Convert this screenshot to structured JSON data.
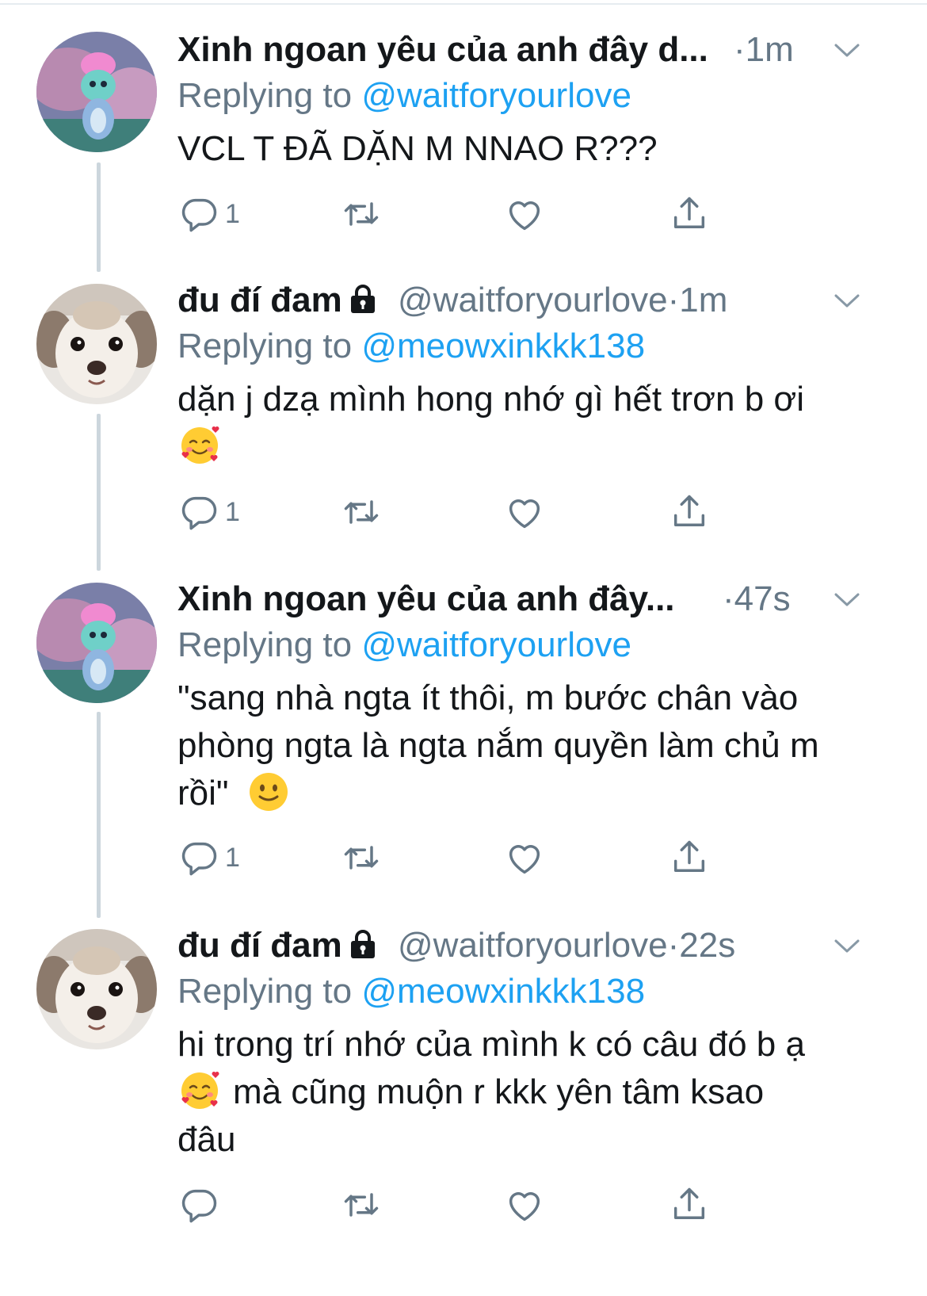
{
  "tweets": [
    {
      "name": "Xinh ngoan yêu của anh đây d...",
      "handle": "",
      "time": "·1m",
      "locked": false,
      "replying_prefix": "Replying to ",
      "replying_to": "@waitforyourlove",
      "text_lines": [
        "VCL T ĐÃ DẶN M NNAO R???"
      ],
      "reply_count": "1",
      "avatar": "pink-hair-cartoon-avatar"
    },
    {
      "name": "đu đí đam",
      "handle": "@waitforyourlove",
      "time": "·1m",
      "locked": true,
      "replying_prefix": "Replying to ",
      "replying_to": "@meowxinkkk138",
      "text_lines": [
        "dặn j dzạ mình hong nhớ gì hết trơn b ơi"
      ],
      "reply_count": "1",
      "avatar": "chihuahua-avatar"
    },
    {
      "name": "Xinh ngoan yêu của anh đây...",
      "handle": "",
      "time": "·47s",
      "locked": false,
      "replying_prefix": "Replying to ",
      "replying_to": "@waitforyourlove",
      "text_lines": [
        "\"sang nhà ngta ít thôi, m bước chân vào",
        "phòng ngta là ngta nắm quyền làm chủ m",
        "rồi\""
      ],
      "reply_count": "1",
      "avatar": "pink-hair-cartoon-avatar"
    },
    {
      "name": "đu đí đam",
      "handle": "@waitforyourlove",
      "time": "·22s",
      "locked": true,
      "replying_prefix": "Replying to ",
      "replying_to": "@meowxinkkk138",
      "text_lines": [
        "hi trong trí nhớ của mình k có câu đó b ạ",
        "mà cũng muộn r kkk yên tâm ksao",
        "đâu"
      ],
      "reply_count": "",
      "avatar": "chihuahua-avatar"
    }
  ],
  "colors": {
    "primary_text": "#14171a",
    "secondary_text": "#657786",
    "mention_blue": "#1da1f2",
    "thread_line": "#ccd6dd"
  },
  "icons": [
    "reply-icon",
    "retweet-icon",
    "like-icon",
    "share-icon",
    "chevron-down-icon",
    "lock-icon"
  ]
}
